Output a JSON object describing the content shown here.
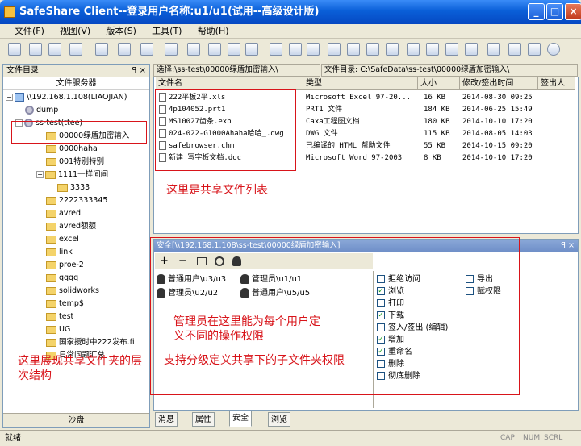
{
  "window": {
    "title": "SafeShare Client--登录用户名称:u1/u1(试用--高级设计版)"
  },
  "menu": [
    "文件(F)",
    "视图(V)",
    "版本(S)",
    "工具(T)",
    "帮助(H)"
  ],
  "left_panel": {
    "header": "文件目录",
    "pin": "ꟼ ×",
    "server_label": "文件服务器",
    "bottom_label": "沙盘",
    "tree": [
      {
        "label": "\\\\192.168.1.108(LIAOJIAN)",
        "icon": "computer-icon"
      },
      {
        "label": "dump",
        "icon": "gear-icon"
      },
      {
        "label": "ss-test(ttee)",
        "icon": "gear-icon"
      },
      {
        "label": "00000绿盾加密输入",
        "icon": "folder-icon"
      },
      {
        "label": "0000haha",
        "icon": "folder-icon"
      },
      {
        "label": "001特别特别",
        "icon": "folder-icon"
      },
      {
        "label": "1111一样间间",
        "icon": "folder-icon"
      },
      {
        "label": "3333",
        "icon": "folder-icon"
      },
      {
        "label": "2222333345",
        "icon": "folder-icon"
      },
      {
        "label": "avred",
        "icon": "folder-icon"
      },
      {
        "label": "avred额额",
        "icon": "folder-icon"
      },
      {
        "label": "excel",
        "icon": "folder-icon"
      },
      {
        "label": "link",
        "icon": "folder-icon"
      },
      {
        "label": "proe-2",
        "icon": "folder-icon"
      },
      {
        "label": "qqqq",
        "icon": "folder-icon"
      },
      {
        "label": "solidworks",
        "icon": "folder-icon"
      },
      {
        "label": "temp$",
        "icon": "folder-icon"
      },
      {
        "label": "test",
        "icon": "folder-icon"
      },
      {
        "label": "UG",
        "icon": "folder-icon"
      },
      {
        "label": "国家授时中222发布.fi",
        "icon": "folder-icon"
      },
      {
        "label": "日常问题汇总",
        "icon": "folder-icon"
      }
    ]
  },
  "path_bar": {
    "select_label": "选择:\\ss-test\\00000绿盾加密输入\\",
    "dir_label": "文件目录: C:\\SafeData\\ss-test\\00000绿盾加密输入\\"
  },
  "file_list": {
    "columns": [
      "文件名",
      "类型",
      "大小",
      "修改/签出时间",
      "签出人"
    ],
    "rows": [
      [
        "222平板2平.xls",
        "Microsoft Excel 97-20...",
        "16 KB",
        "2014-08-30 09:25",
        ""
      ],
      [
        "4p104052.prt1",
        "PRT1 文件",
        "184 KB",
        "2014-06-25 15:49",
        ""
      ],
      [
        "MS10027齿条.exb",
        "Caxa工程图文档",
        "180 KB",
        "2014-10-10 17:20",
        ""
      ],
      [
        "024-022-G1000Ahaha哈哈_.dwg",
        "DWG 文件",
        "115 KB",
        "2014-08-05 14:03",
        ""
      ],
      [
        "safebrowser.chm",
        "已编译的 HTML 帮助文件",
        "55 KB",
        "2014-10-15 09:20",
        ""
      ],
      [
        "新建 写字板文档.doc",
        "Microsoft Word 97-2003",
        "8 KB",
        "2014-10-10 17:20",
        ""
      ]
    ]
  },
  "security_panel": {
    "header": "安全[\\\\192.168.1.108\\ss-test\\00000绿盾加密输入]",
    "tools": [
      "+",
      "−"
    ],
    "users": [
      "普通用户\\u3/u3",
      "管理员\\u1/u1",
      "管理员\\u2/u2",
      "普通用户\\u5/u5"
    ],
    "permissions_left": [
      {
        "label": "拒绝访问",
        "checked": false
      },
      {
        "label": "浏览",
        "checked": true
      },
      {
        "label": "打印",
        "checked": false
      },
      {
        "label": "下载",
        "checked": true
      },
      {
        "label": "签入/签出 (编辑)",
        "checked": false
      },
      {
        "label": "增加",
        "checked": true
      },
      {
        "label": "重命名",
        "checked": true
      },
      {
        "label": "删除",
        "checked": false
      },
      {
        "label": "彻底删除",
        "checked": false
      }
    ],
    "permissions_right": [
      {
        "label": "导出",
        "checked": false
      },
      {
        "label": "赋权限",
        "checked": false
      }
    ]
  },
  "bottom_tabs": [
    "消息",
    "属性",
    "安全",
    "浏览"
  ],
  "annotations": {
    "file_list": "这里是共享文件列表",
    "admin": "管理员在这里能为每个用户定义不同的操作权限",
    "subfolder": "支持分级定义共享下的子文件夹权限",
    "tree": "这里展现共享文件夹的层次结构"
  },
  "status": {
    "left": "就绪",
    "indicators": [
      "CAP",
      "NUM",
      "SCRL"
    ]
  },
  "colors": {
    "annotation": "#d8141a",
    "titlebar": "#0a5fd8"
  }
}
